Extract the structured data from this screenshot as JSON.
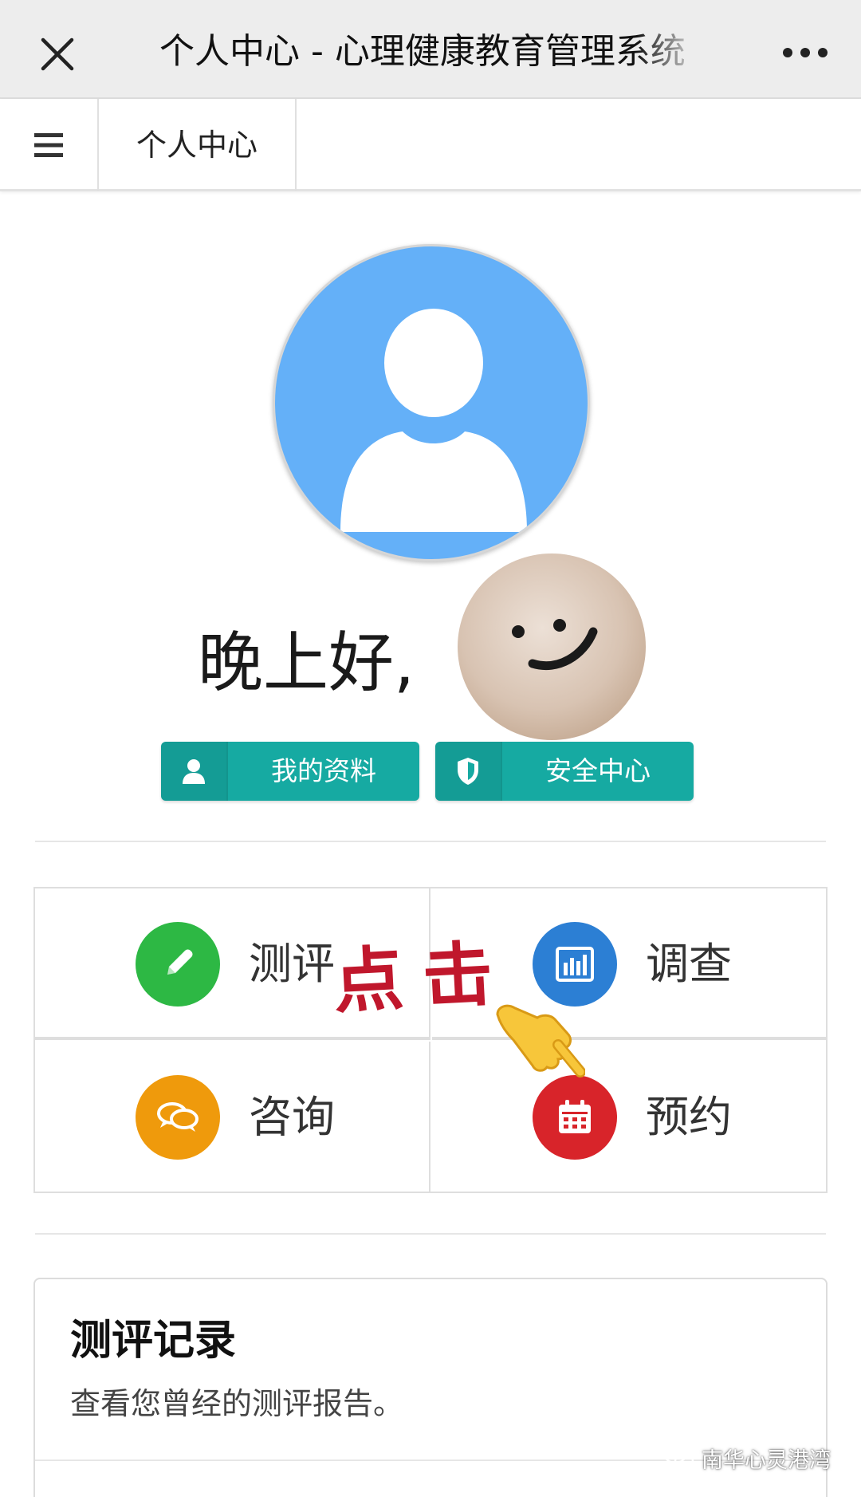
{
  "topbar": {
    "title": "个人中心 - 心理健康教育管理系统",
    "close_icon": "close-icon",
    "more_icon": "more-dots-icon"
  },
  "navbar": {
    "menu_icon": "hamburger-menu-icon",
    "active_tab": "个人中心"
  },
  "profile": {
    "avatar_icon": "default-user-avatar",
    "greeting": "晚上好,",
    "buttons": [
      {
        "label": "我的资料",
        "icon": "user-icon"
      },
      {
        "label": "安全中心",
        "icon": "shield-icon"
      }
    ]
  },
  "features": [
    {
      "label": "测评",
      "icon": "pencil-icon",
      "color": "#2db844"
    },
    {
      "label": "调查",
      "icon": "bar-chart-icon",
      "color": "#2c7fd4"
    },
    {
      "label": "咨询",
      "icon": "chat-bubbles-icon",
      "color": "#ef9a0c"
    },
    {
      "label": "预约",
      "icon": "calendar-icon",
      "color": "#d8242a"
    }
  ],
  "overlay": {
    "click_text": "点击",
    "hand_icon": "pointing-hand-emoji"
  },
  "record_card": {
    "title": "测评记录",
    "description": "查看您曾经的测评报告。"
  },
  "watermark": {
    "text": "南华心灵港湾",
    "icon": "wechat-icon"
  },
  "colors": {
    "teal_button": "#16aaa2",
    "avatar_blue": "#64b0f8",
    "overlay_red": "#c0172c"
  }
}
